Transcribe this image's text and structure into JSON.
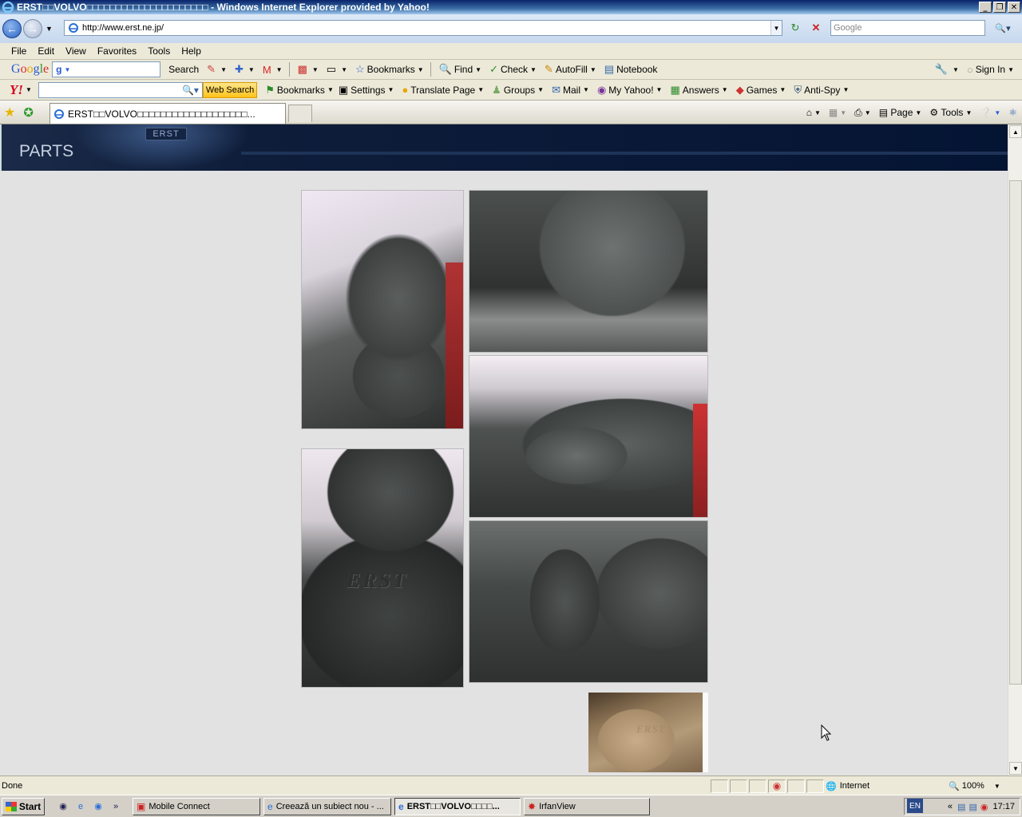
{
  "window": {
    "title": "ERST□□VOLVO□□□□□□□□□□□□□□□□□□□□□ - Windows Internet Explorer provided by Yahoo!",
    "controls": [
      "_",
      "❐",
      "✕"
    ]
  },
  "address_bar": {
    "url": "http://www.erst.ne.jp/",
    "search_placeholder": "Google"
  },
  "menu": [
    "File",
    "Edit",
    "View",
    "Favorites",
    "Tools",
    "Help"
  ],
  "google_toolbar": {
    "logo": "Google",
    "input_value": "g",
    "search_label": "Search",
    "bookmarks_label": "Bookmarks",
    "find_label": "Find",
    "check_label": "Check",
    "autofill_label": "AutoFill",
    "notebook_label": "Notebook",
    "signin_label": "Sign In"
  },
  "yahoo_toolbar": {
    "logo": "Y!",
    "web_search_label": "Web Search",
    "items": [
      "Bookmarks",
      "Settings",
      "Translate Page",
      "Groups",
      "Mail",
      "My Yahoo!",
      "Answers",
      "Games",
      "Anti-Spy"
    ]
  },
  "tabs": {
    "active_title": "ERST□□VOLVO□□□□□□□□□□□□□□□□□□□..."
  },
  "command_bar": {
    "page_label": "Page",
    "tools_label": "Tools"
  },
  "page": {
    "section_heading": "PARTS",
    "plate_text": "ERST",
    "photo_logo_text": "ERST"
  },
  "status_bar": {
    "status": "Done",
    "zone": "Internet",
    "zoom": "100%"
  },
  "taskbar": {
    "start_label": "Start",
    "tasks": [
      "Mobile Connect",
      "Creează un subiect nou - ...",
      "ERST□□VOLVO□□□□...",
      "IrfanView"
    ],
    "lang": "EN",
    "clock": "17:17"
  },
  "colors": {
    "header_band": "#041433",
    "content_bg": "#e2e2e2",
    "titlebar": "#0a246a"
  }
}
